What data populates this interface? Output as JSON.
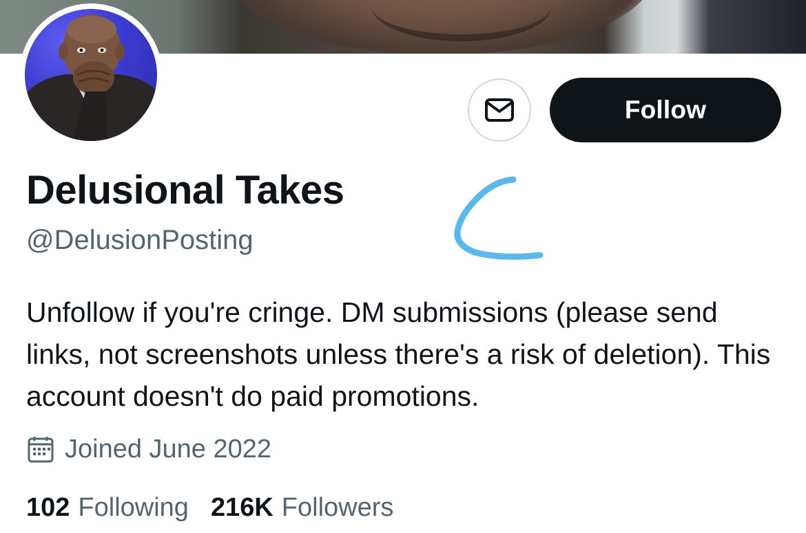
{
  "profile": {
    "display_name": "Delusional Takes",
    "handle": "@DelusionPosting",
    "bio": "Unfollow if you're cringe. DM submissions (please send links, not screenshots unless there's a risk of deletion). This account doesn't do paid promotions.",
    "joined": "Joined June 2022"
  },
  "actions": {
    "message_icon": "envelope-icon",
    "follow_label": "Follow"
  },
  "stats": {
    "following_count": "102",
    "following_label": "Following",
    "followers_count": "216K",
    "followers_label": "Followers"
  },
  "icons": {
    "joined": "calendar-icon"
  },
  "colors": {
    "primary_text": "#0f1419",
    "secondary_text": "#536471",
    "follow_button_bg": "#0f1419",
    "scribble": "#5bb8ec"
  }
}
